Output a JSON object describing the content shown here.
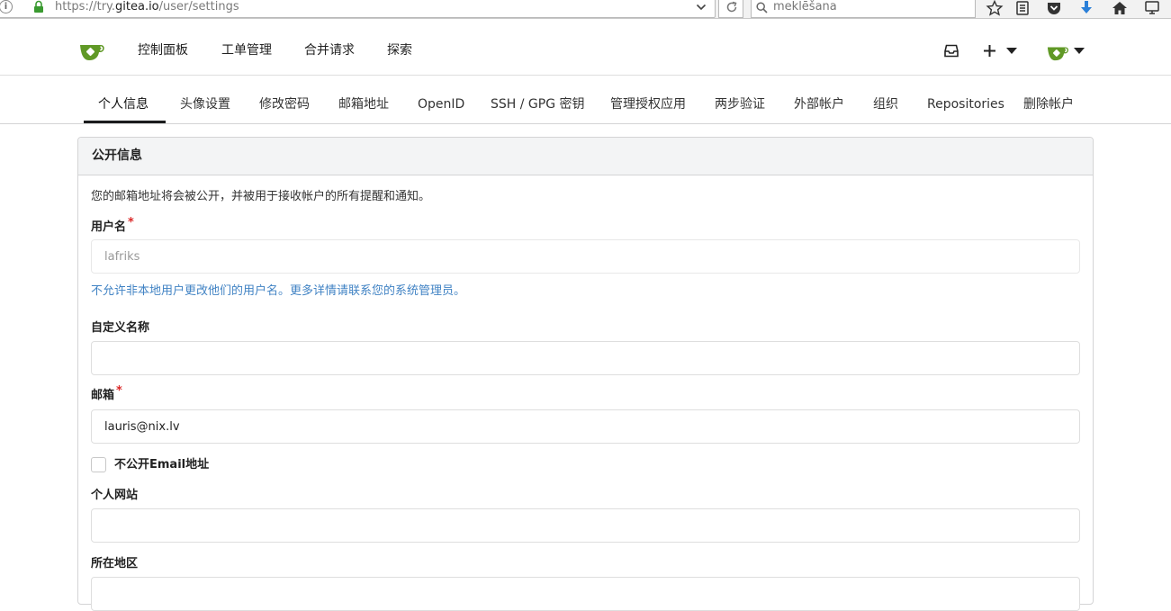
{
  "browser": {
    "url_scheme": "https://try.",
    "url_host": "gitea.io",
    "url_path": "/user/settings",
    "search_placeholder": "meklēšana",
    "toolbar_icons": [
      "star-icon",
      "reader-icon",
      "pocket-icon",
      "download-icon",
      "home-icon",
      "sync-icon"
    ],
    "download_color": "#2a7fd8"
  },
  "header": {
    "nav": [
      "控制面板",
      "工单管理",
      "合并请求",
      "探索"
    ],
    "brand_color": "#609926"
  },
  "tabs": {
    "items": [
      "个人信息",
      "头像设置",
      "修改密码",
      "邮箱地址",
      "OpenID",
      "SSH / GPG 密钥",
      "管理授权应用",
      "两步验证",
      "外部帐户",
      "组织",
      "Repositories",
      "删除帐户"
    ],
    "active_index": 0
  },
  "profile": {
    "section_title": "公开信息",
    "help": "您的邮箱地址将会被公开，并被用于接收帐户的所有提醒和通知。",
    "username_label": "用户名",
    "username_value": "lafriks",
    "username_note": "不允许非本地用户更改他们的用户名。更多详情请联系您的系统管理员。",
    "fullname_label": "自定义名称",
    "fullname_value": "",
    "email_label": "邮箱",
    "email_value": "lauris@nix.lv",
    "hide_email_label": "不公开Email地址",
    "website_label": "个人网站",
    "website_value": "",
    "location_label": "所在地区",
    "location_value": "",
    "required_mark": "*"
  }
}
